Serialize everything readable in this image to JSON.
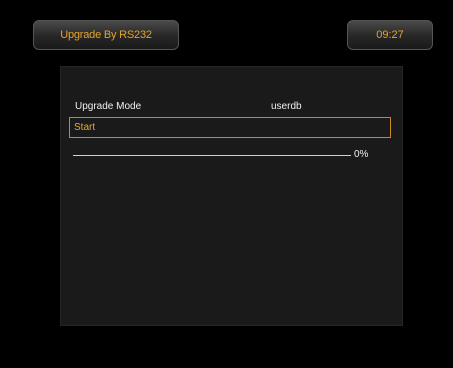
{
  "header": {
    "title": "Upgrade By RS232",
    "clock": "09:27"
  },
  "upgrade": {
    "mode_label": "Upgrade Mode",
    "mode_value": "userdb",
    "start_label": "Start",
    "progress_value": 0,
    "progress_text": "0%"
  },
  "colors": {
    "accent": "#e5a32a",
    "background": "#000000",
    "panel": "#1a1a1a",
    "highlight_border": "#c58a1e"
  }
}
